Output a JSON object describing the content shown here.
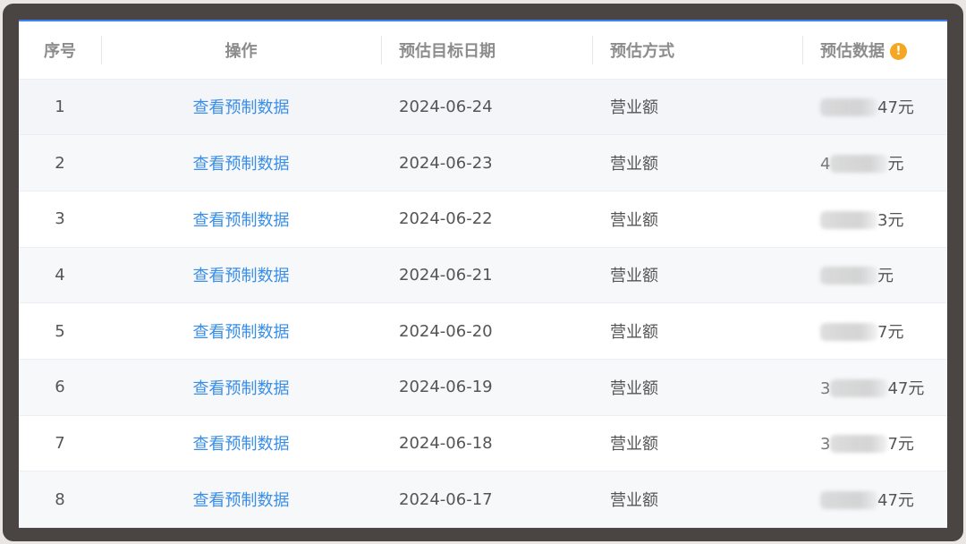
{
  "table": {
    "headers": {
      "index": "序号",
      "operation": "操作",
      "target_date": "预估目标日期",
      "method": "预估方式",
      "value": "预估数据"
    },
    "rows": [
      {
        "index": "1",
        "action": "查看预制数据",
        "date": "2024-06-24",
        "method": "营业额",
        "value_prefix": "",
        "value_suffix": "47元"
      },
      {
        "index": "2",
        "action": "查看预制数据",
        "date": "2024-06-23",
        "method": "营业额",
        "value_prefix": "4",
        "value_suffix": "元"
      },
      {
        "index": "3",
        "action": "查看预制数据",
        "date": "2024-06-22",
        "method": "营业额",
        "value_prefix": "",
        "value_suffix": "3元"
      },
      {
        "index": "4",
        "action": "查看预制数据",
        "date": "2024-06-21",
        "method": "营业额",
        "value_prefix": "",
        "value_suffix": "元"
      },
      {
        "index": "5",
        "action": "查看预制数据",
        "date": "2024-06-20",
        "method": "营业额",
        "value_prefix": "",
        "value_suffix": "7元"
      },
      {
        "index": "6",
        "action": "查看预制数据",
        "date": "2024-06-19",
        "method": "营业额",
        "value_prefix": "3",
        "value_suffix": "47元"
      },
      {
        "index": "7",
        "action": "查看预制数据",
        "date": "2024-06-18",
        "method": "营业额",
        "value_prefix": "3",
        "value_suffix": "7元"
      },
      {
        "index": "8",
        "action": "查看预制数据",
        "date": "2024-06-17",
        "method": "营业额",
        "value_prefix": "",
        "value_suffix": "47元"
      }
    ]
  },
  "colors": {
    "link": "#3a8ee6",
    "header_text": "#8c8c8c",
    "warning_icon": "#f5a623",
    "accent_border": "#3b82f6"
  },
  "icons": {
    "value_header_icon": "warning-info-icon"
  }
}
